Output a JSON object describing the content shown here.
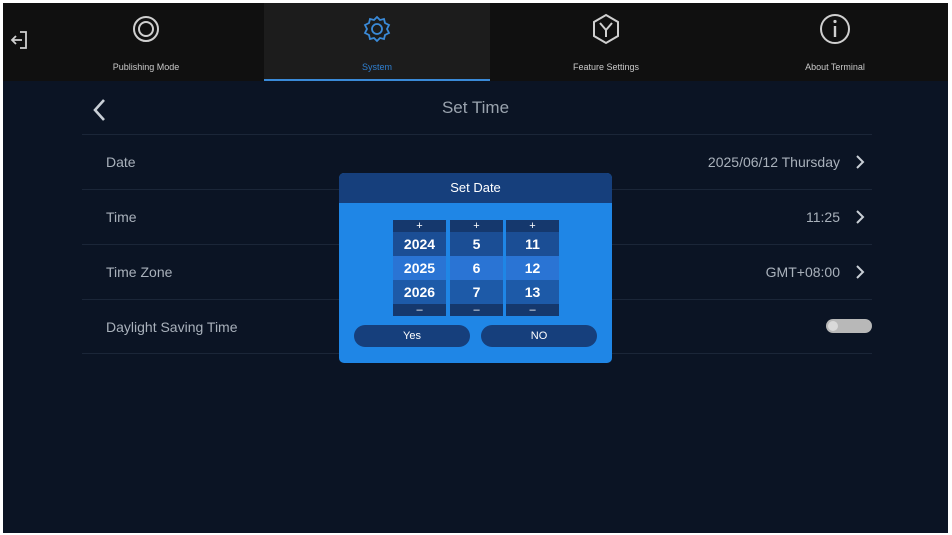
{
  "nav": {
    "tabs": [
      {
        "label": "Publishing Mode",
        "icon": "publishing-mode-icon"
      },
      {
        "label": "System",
        "icon": "gear-icon"
      },
      {
        "label": "Feature Settings",
        "icon": "feature-settings-icon"
      },
      {
        "label": "About Terminal",
        "icon": "info-icon"
      }
    ],
    "active_tab": "System"
  },
  "page": {
    "title": "Set Time",
    "rows": [
      {
        "label": "Date",
        "value": "2025/06/12  Thursday"
      },
      {
        "label": "Time",
        "value": "11:25"
      },
      {
        "label": "Time Zone",
        "value": "GMT+08:00"
      },
      {
        "label": "Daylight Saving Time",
        "toggle": "off"
      }
    ]
  },
  "dialog": {
    "title": "Set Date",
    "plus": "+",
    "minus": "–",
    "year": [
      "2024",
      "2025",
      "2026"
    ],
    "month": [
      "5",
      "6",
      "7"
    ],
    "day": [
      "11",
      "12",
      "13"
    ],
    "yes_label": "Yes",
    "no_label": "NO"
  },
  "colors": {
    "accent": "#2f7fd0",
    "dialog_bg": "#1f86e6",
    "dialog_header": "#163f7c",
    "screen_bg": "#0b1424"
  }
}
